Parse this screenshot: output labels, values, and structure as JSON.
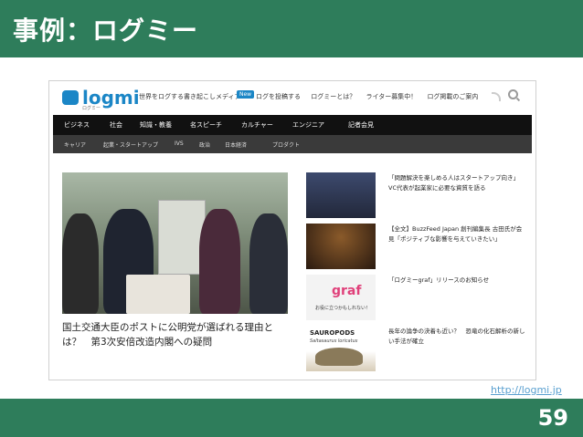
{
  "slide": {
    "title": "事例：ログミー",
    "page_number": "59",
    "url": "http://logmi.jp"
  },
  "site": {
    "logo_text": "logmi",
    "logo_sub": "ログミー",
    "tagline": "世界をログする書き起こしメディア",
    "new_badge": "New",
    "top_links": [
      "ログを投稿する",
      "ログミーとは？",
      "ライター募集中！",
      "ログ掲載のご案内"
    ],
    "nav_main": [
      "ビジネス",
      "社会",
      "知識・教養",
      "名スピーチ",
      "カルチャー",
      "エンジニア",
      "記者会見"
    ],
    "nav_sub": [
      "キャリア",
      "起業・スタートアップ",
      "IVS",
      "政治",
      "日本経済",
      "プロダクト"
    ],
    "hero_caption": "国土交通大臣のポストに公明党が選ばれる理由とは？　第3次安倍改造内閣への疑問",
    "side_items": [
      {
        "text": "「問題解決を楽しめる人はスタートアップ向き」 VC代表が起業家に必要な資質を語る",
        "thumb": "crowd"
      },
      {
        "text": "【全文】BuzzFeed Japan 創刊編集長 古田氏が会見「ポジティブな影響を与えていきたい」",
        "thumb": "speaker"
      },
      {
        "text": "「ログミーgraf」リリースのお知らせ",
        "thumb": "graf",
        "thumb_label": "graf",
        "thumb_sub": "お役に立つかもしれない！"
      },
      {
        "text": "長年の論争の決着も近い？　恐竜の化石解析の新しい手法が確立",
        "thumb": "dino",
        "thumb_label": "SAUROPODS",
        "thumb_sub": "Saltasaurus loricatus"
      }
    ]
  }
}
